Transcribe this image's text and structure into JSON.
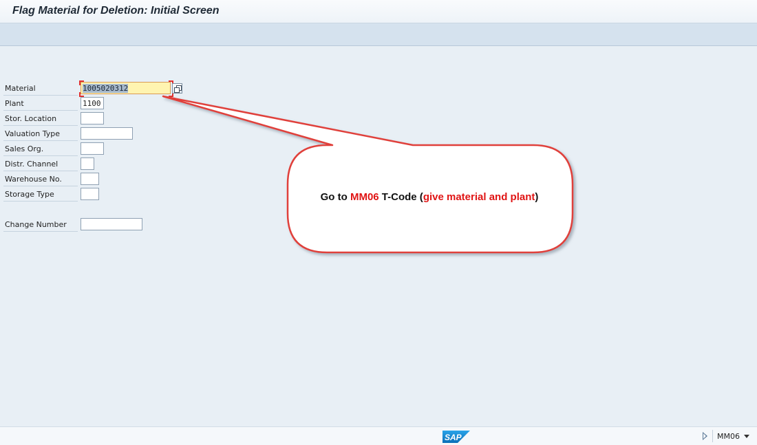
{
  "window": {
    "title": "Flag Material for Deletion: Initial Screen"
  },
  "form": {
    "fields": [
      {
        "label": "Material",
        "value": "1005020312"
      },
      {
        "label": "Plant",
        "value": "1100"
      },
      {
        "label": "Stor. Location",
        "value": ""
      },
      {
        "label": "Valuation Type",
        "value": ""
      },
      {
        "label": "Sales Org.",
        "value": ""
      },
      {
        "label": "Distr. Channel",
        "value": ""
      },
      {
        "label": "Warehouse No.",
        "value": ""
      },
      {
        "label": "Storage Type",
        "value": ""
      },
      {
        "label": "Change Number",
        "value": ""
      }
    ]
  },
  "callout": {
    "part1": "Go to ",
    "tcode": "MM06",
    "part2": " T-Code (",
    "hint": "give material and plant",
    "part3": ")"
  },
  "status_bar": {
    "logo": "SAP",
    "tcode": "MM06"
  },
  "colors": {
    "accent_red": "#e01414",
    "callout_border": "#e0403a",
    "sap_blue": "#1d8fd8"
  }
}
